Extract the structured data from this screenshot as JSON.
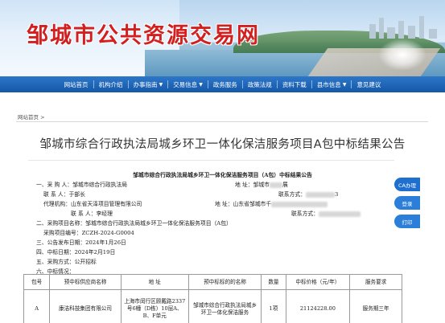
{
  "header": {
    "site_title": "邹城市公共资源交易网"
  },
  "nav": {
    "items": [
      {
        "label": "网站首页",
        "dropdown": false
      },
      {
        "label": "机构介绍",
        "dropdown": false
      },
      {
        "label": "办事指南",
        "dropdown": true
      },
      {
        "label": "交易信息",
        "dropdown": true
      },
      {
        "label": "政务服务",
        "dropdown": false
      },
      {
        "label": "政策法规",
        "dropdown": false
      },
      {
        "label": "资料下载",
        "dropdown": false
      },
      {
        "label": "县市信息",
        "dropdown": true
      },
      {
        "label": "意见建议",
        "dropdown": false
      }
    ]
  },
  "breadcrumb": "网站首页 >",
  "article": {
    "title": "邹城市综合行政执法局城乡环卫一体化保洁服务项目A包中标结果公告",
    "notice_heading": "邹城市综合行政执法局城乡环卫一体化保洁服务项目（A包）中标结果公告",
    "lines": {
      "l1_label": "一、采 购 人：邹城市综合行政执法局",
      "l1_addr_label": "地    址：邹城市",
      "l1_addr_tail": "展",
      "l2_contact": "联 系 人：于部长",
      "l2_phone_label": "联系方式：",
      "l2_phone_tail": "3",
      "l3_agent": "代理机构：山东省天泽项目管理有限公司",
      "l3_addr_label": "地    址：山东省邹城市千",
      "l4_contact": "联 系 人：李经理",
      "l4_phone_label": "联系方式：",
      "l5": "二、采购项目名称：邹城市综合行政执法局城乡环卫一体化保洁服务项目（A包）",
      "l6": "采购项目编号：ZCZH-2024-G0004",
      "l7": "三、公告发布日期：2024年1月26日",
      "l8": "四、中标日期：2024年2月19日",
      "l9": "五、采购方式：公开招标",
      "l10": "六、中标情况："
    },
    "table": {
      "headers": [
        "包号",
        "预中标供应商名称",
        "地    址",
        "预中标标的的名称",
        "数量",
        "中标价格（元/年）",
        "服务要求"
      ],
      "rows": [
        [
          "A",
          "康洁科技集团有限公司",
          "上海市闵行区顾戴路2337号6幢（D栋）10层A、B、F单元",
          "邹城市综合行政执法局城乡环卫一体化保洁服务",
          "1项",
          "21124228.00",
          "服务期三年"
        ]
      ]
    }
  },
  "side_buttons": {
    "ca": "CA办理",
    "login": "登录",
    "print": "打印"
  },
  "colors": {
    "brand_red": "#d21f1f",
    "nav_blue": "#1a62b8",
    "float_blue": "#1f6fcf"
  }
}
